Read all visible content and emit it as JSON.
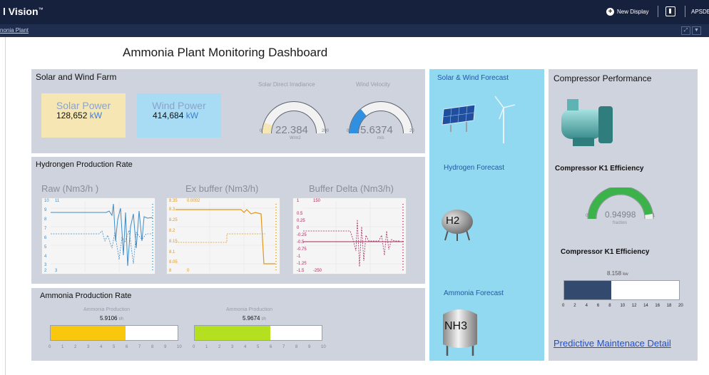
{
  "app": {
    "name": "l Vision",
    "trademark": "™",
    "new_display": "New Display",
    "user": "APSDE",
    "plus_glyph": "+"
  },
  "breadcrumb": "nonia Plant",
  "toolbar": {
    "trend_glyph": "⤢",
    "menu_glyph": "▼"
  },
  "page_title": "Ammonia Plant Monitoring Dashboard",
  "solar_wind": {
    "title": "Solar and Wind Farm",
    "solar": {
      "label": "Solar Power",
      "value": "128,652",
      "unit": "kW"
    },
    "wind": {
      "label": "Wind Power",
      "value": "414,684",
      "unit": "kW"
    },
    "irradiance": {
      "label": "Solar Direct Irradiance",
      "value": "22.384",
      "unit": "W/m2",
      "min": "0",
      "max": "200",
      "level": 0.11
    },
    "velocity": {
      "label": "Wind Velocity",
      "value": "5.6374",
      "unit": "m/s",
      "min": "0",
      "max": "20",
      "level": 0.28
    }
  },
  "hydrogen": {
    "title": "Hydrongen Production Rate",
    "charts": [
      {
        "title": "Raw  (Nm3/h )",
        "top_tick_a": "10",
        "top_tick_b": "11",
        "ticks": [
          "9",
          "8",
          "7",
          "6",
          "5",
          "4",
          "3"
        ],
        "bottom_tick_a": "2",
        "bottom_tick_b": "3"
      },
      {
        "title": "Ex buffer  (Nm3/h)",
        "top_tick_a": "8.35",
        "top_tick_b": "0.0002",
        "ticks": [
          "8.3",
          "8.25",
          "8.2",
          "8.15",
          "8.1",
          "8.05"
        ],
        "bottom_tick_a": "8",
        "bottom_tick_b": "0"
      },
      {
        "title": "Buffer Delta  (Nm3/h)",
        "top_tick_a": "1",
        "top_tick_b": "150",
        "ticks": [
          "0.5",
          "0.25",
          "0",
          "-0.25",
          "-0.5",
          "-0.75",
          "-1",
          "-1.25"
        ],
        "bottom_tick_a": "-1.5",
        "bottom_tick_b": "-250"
      }
    ]
  },
  "ammonia": {
    "title": "Ammonia  Production Rate",
    "bars": [
      {
        "label": "Ammonia Production",
        "value": "5.9106",
        "unit": "t/h",
        "level": 0.59106,
        "color": "#f9c80e"
      },
      {
        "label": "Ammonia Production",
        "value": "5.9674",
        "unit": "t/h",
        "level": 0.59674,
        "color": "#b4e01f"
      }
    ],
    "scale": [
      "0",
      "1",
      "2",
      "3",
      "4",
      "5",
      "6",
      "7",
      "8",
      "9",
      "10"
    ]
  },
  "forecast": {
    "solar_wind": "Solar & Wind Forecast",
    "hydrogen": "Hydrogen Forecast",
    "h2_label": "H2",
    "ammonia": "Ammonia Forecast",
    "nh3_label": "NH3"
  },
  "compressor": {
    "title": "Compressor Performance",
    "eff_title_1": "Compressor K1 Efficiency",
    "gauge": {
      "value": "0.94998",
      "unit": "fraction",
      "min": "0",
      "max": "1",
      "level": 0.95
    },
    "eff_title_2": "Compressor K1 Efficiency",
    "bar": {
      "value": "8.158",
      "unit": "kw",
      "level": 0.4079
    },
    "scale": [
      "0",
      "2",
      "4",
      "6",
      "8",
      "10",
      "12",
      "14",
      "16",
      "18",
      "20"
    ],
    "link": "Predictive Maintenace Detail"
  },
  "colors": {
    "header": "#16213d",
    "panel": "#cfd3de",
    "forecast_panel": "#90d9f0",
    "solar_card": "#f5e6b4",
    "wind_card": "#a8dcf4",
    "gauge_green": "#3cb34a",
    "bar_navy": "#34496e"
  }
}
